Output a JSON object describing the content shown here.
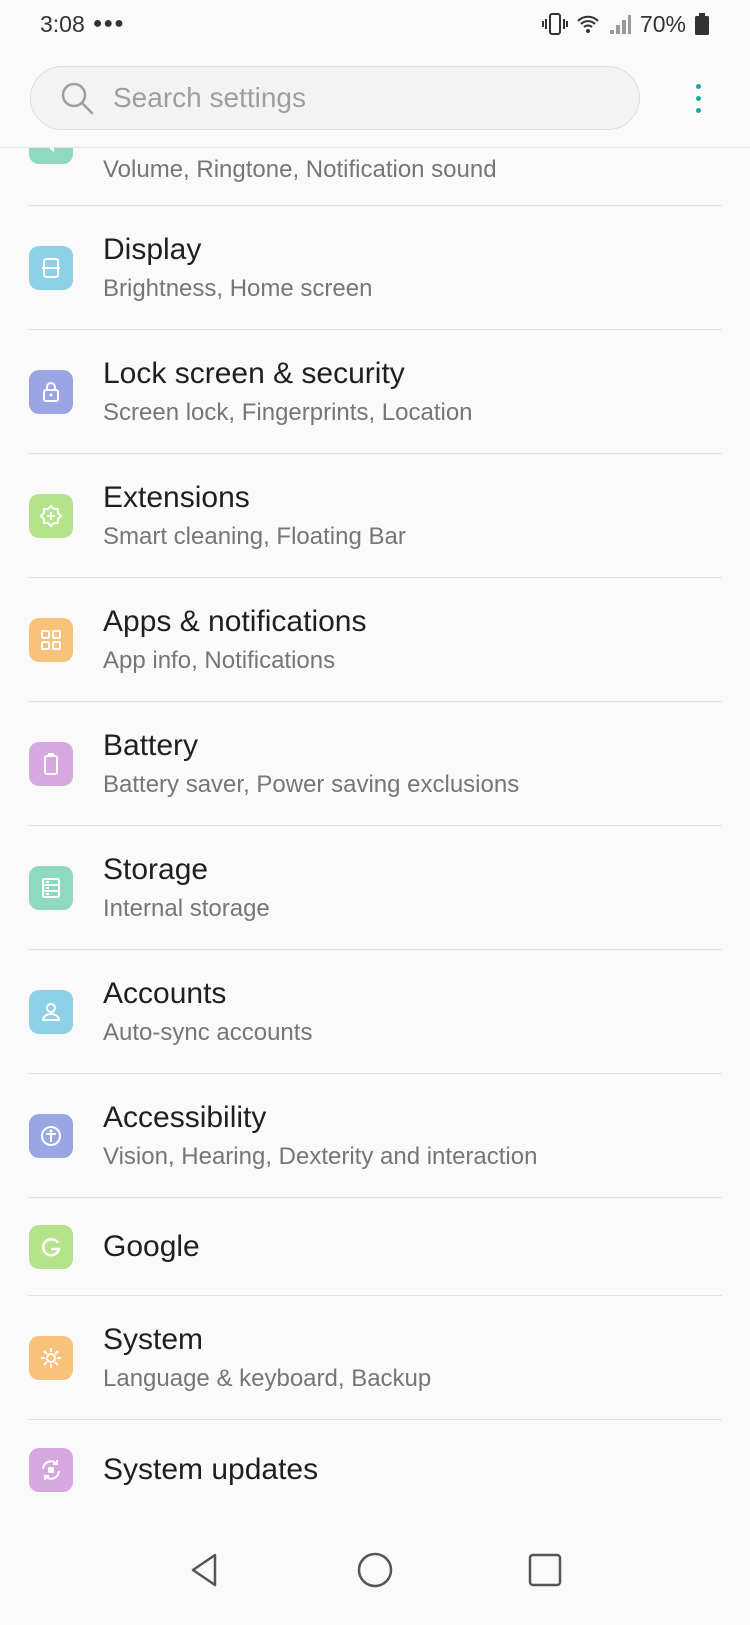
{
  "status": {
    "time": "3:08",
    "battery": "70%"
  },
  "search": {
    "placeholder": "Search settings"
  },
  "items": [
    {
      "title": "",
      "subtitle": "Volume, Ringtone, Notification sound",
      "color": "#8fd9c1",
      "icon": "sound-icon"
    },
    {
      "title": "Display",
      "subtitle": "Brightness, Home screen",
      "color": "#8ed0e6",
      "icon": "display-icon"
    },
    {
      "title": "Lock screen & security",
      "subtitle": "Screen lock, Fingerprints, Location",
      "color": "#9aa6e3",
      "icon": "lock-icon"
    },
    {
      "title": "Extensions",
      "subtitle": "Smart cleaning, Floating Bar",
      "color": "#b5e38a",
      "icon": "extensions-icon"
    },
    {
      "title": "Apps & notifications",
      "subtitle": "App info, Notifications",
      "color": "#f8c27b",
      "icon": "apps-icon"
    },
    {
      "title": "Battery",
      "subtitle": "Battery saver, Power saving exclusions",
      "color": "#d7a7e0",
      "icon": "battery-icon"
    },
    {
      "title": "Storage",
      "subtitle": "Internal storage",
      "color": "#8fd9c1",
      "icon": "storage-icon"
    },
    {
      "title": "Accounts",
      "subtitle": "Auto-sync accounts",
      "color": "#8ed0e6",
      "icon": "account-icon"
    },
    {
      "title": "Accessibility",
      "subtitle": "Vision, Hearing, Dexterity and interaction",
      "color": "#9aa6e3",
      "icon": "accessibility-icon"
    },
    {
      "title": "Google",
      "subtitle": "",
      "color": "#b5e38a",
      "icon": "google-icon"
    },
    {
      "title": "System",
      "subtitle": "Language & keyboard, Backup",
      "color": "#f8c27b",
      "icon": "gear-icon"
    },
    {
      "title": "System updates",
      "subtitle": "",
      "color": "#d7a7e0",
      "icon": "system-update-icon"
    }
  ]
}
